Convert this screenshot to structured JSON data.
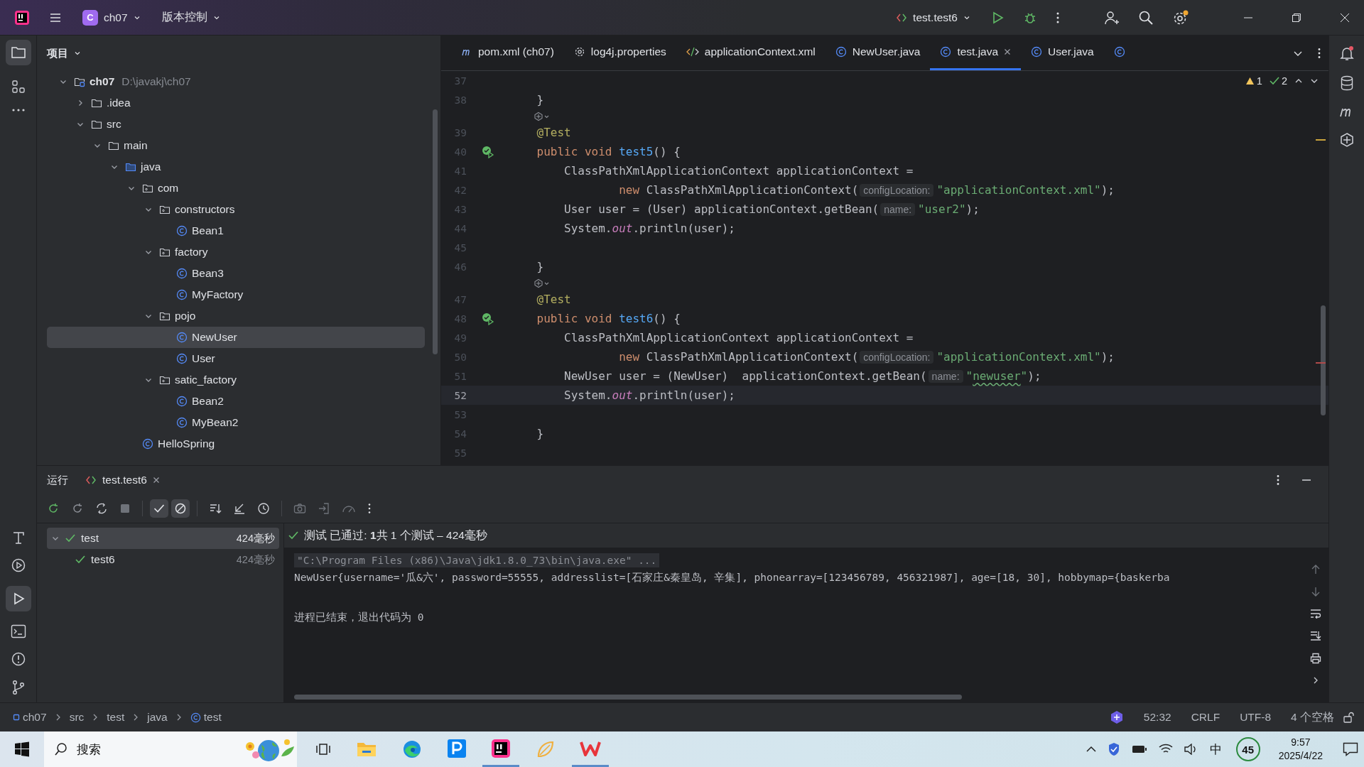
{
  "title_bar": {
    "project_badge": "C",
    "project": "ch07",
    "vcs": "版本控制",
    "run_config": "test.test6",
    "settings_update": true
  },
  "project_panel": {
    "title": "项目",
    "tree": [
      {
        "kind": "project",
        "label": "ch07",
        "path": "D:\\javakj\\ch07",
        "expanded": true,
        "selected": false,
        "children": [
          {
            "kind": "folder",
            "label": ".idea",
            "expanded": false,
            "selected": false
          },
          {
            "kind": "folder",
            "label": "src",
            "expanded": true,
            "selected": false,
            "children": [
              {
                "kind": "folder",
                "label": "main",
                "expanded": true,
                "selected": false,
                "children": [
                  {
                    "kind": "source-folder",
                    "label": "java",
                    "expanded": true,
                    "selected": false,
                    "children": [
                      {
                        "kind": "package",
                        "label": "com",
                        "expanded": true,
                        "selected": false,
                        "children": [
                          {
                            "kind": "package",
                            "label": "constructors",
                            "expanded": true,
                            "selected": false,
                            "children": [
                              {
                                "kind": "class",
                                "label": "Bean1",
                                "selected": false
                              }
                            ]
                          },
                          {
                            "kind": "package",
                            "label": "factory",
                            "expanded": true,
                            "selected": false,
                            "children": [
                              {
                                "kind": "class",
                                "label": "Bean3",
                                "selected": false
                              },
                              {
                                "kind": "class",
                                "label": "MyFactory",
                                "selected": false
                              }
                            ]
                          },
                          {
                            "kind": "package",
                            "label": "pojo",
                            "expanded": true,
                            "selected": false,
                            "children": [
                              {
                                "kind": "class",
                                "label": "NewUser",
                                "selected": true
                              },
                              {
                                "kind": "class",
                                "label": "User",
                                "selected": false
                              }
                            ]
                          },
                          {
                            "kind": "package",
                            "label": "satic_factory",
                            "expanded": true,
                            "selected": false,
                            "children": [
                              {
                                "kind": "class",
                                "label": "Bean2",
                                "selected": false
                              },
                              {
                                "kind": "class",
                                "label": "MyBean2",
                                "selected": false
                              }
                            ]
                          }
                        ]
                      },
                      {
                        "kind": "class",
                        "label": "HelloSpring",
                        "selected": false
                      }
                    ]
                  }
                ]
              }
            ]
          }
        ]
      }
    ]
  },
  "tabs": [
    {
      "kind": "maven",
      "label": "pom.xml (ch07)",
      "selected": false
    },
    {
      "kind": "properties",
      "label": "log4j.properties",
      "selected": false
    },
    {
      "kind": "xml",
      "label": "applicationContext.xml",
      "selected": false
    },
    {
      "kind": "class",
      "label": "NewUser.java",
      "selected": false
    },
    {
      "kind": "class",
      "label": "test.java",
      "selected": true
    },
    {
      "kind": "class",
      "label": "User.java",
      "selected": false
    },
    {
      "kind": "class",
      "selected": false
    }
  ],
  "editor": {
    "warnings": "1",
    "checks": "2",
    "lines": [
      {
        "kind": "code",
        "number": "37",
        "current": false,
        "run_marker": false
      },
      {
        "kind": "code",
        "number": "38",
        "current": false,
        "run_marker": false,
        "tokens": [
          {
            "t": "    }",
            "kind": "plain"
          }
        ]
      },
      {
        "kind": "inlay"
      },
      {
        "kind": "code",
        "number": "39",
        "current": false,
        "run_marker": false,
        "tokens": [
          {
            "t": "    @Test",
            "kind": "anno"
          }
        ]
      },
      {
        "kind": "code",
        "number": "40",
        "current": false,
        "run_marker": true,
        "tokens": [
          {
            "t": "    public void ",
            "kind": "kw"
          },
          {
            "t": "test5",
            "kind": "fn"
          },
          {
            "t": "() {",
            "kind": "plain"
          }
        ]
      },
      {
        "kind": "code",
        "number": "41",
        "current": false,
        "run_marker": false,
        "tokens": [
          {
            "t": "        ClassPathXmlApplicationContext applicationContext =",
            "kind": "plain"
          }
        ]
      },
      {
        "kind": "code",
        "number": "42",
        "current": false,
        "run_marker": false,
        "tokens": [
          {
            "t": "                new ",
            "kind": "kw"
          },
          {
            "t": "ClassPathXmlApplicationContext(",
            "kind": "plain"
          },
          {
            "t": "configLocation:",
            "kind": "hint"
          },
          {
            "t": "\"applicationContext.xml\"",
            "kind": "str"
          },
          {
            "t": ");",
            "kind": "plain"
          }
        ]
      },
      {
        "kind": "code",
        "number": "43",
        "current": false,
        "run_marker": false,
        "tokens": [
          {
            "t": "        User user = (User) applicationContext.getBean(",
            "kind": "plain"
          },
          {
            "t": "name:",
            "kind": "hint"
          },
          {
            "t": "\"user2\"",
            "kind": "str"
          },
          {
            "t": ");",
            "kind": "plain"
          }
        ]
      },
      {
        "kind": "code",
        "number": "44",
        "current": false,
        "run_marker": false,
        "tokens": [
          {
            "t": "        System.",
            "kind": "plain"
          },
          {
            "t": "out",
            "kind": "field"
          },
          {
            "t": ".println(user);",
            "kind": "plain"
          }
        ]
      },
      {
        "kind": "code",
        "number": "45",
        "current": false,
        "run_marker": false
      },
      {
        "kind": "code",
        "number": "46",
        "current": false,
        "run_marker": false,
        "tokens": [
          {
            "t": "    }",
            "kind": "plain"
          }
        ]
      },
      {
        "kind": "inlay"
      },
      {
        "kind": "code",
        "number": "47",
        "current": false,
        "run_marker": false,
        "tokens": [
          {
            "t": "    @Test",
            "kind": "anno"
          }
        ]
      },
      {
        "kind": "code",
        "number": "48",
        "current": false,
        "run_marker": true,
        "tokens": [
          {
            "t": "    public void ",
            "kind": "kw"
          },
          {
            "t": "test6",
            "kind": "fn"
          },
          {
            "t": "() {",
            "kind": "plain"
          }
        ]
      },
      {
        "kind": "code",
        "number": "49",
        "current": false,
        "run_marker": false,
        "tokens": [
          {
            "t": "        ClassPathXmlApplicationContext applicationContext =",
            "kind": "plain"
          }
        ]
      },
      {
        "kind": "code",
        "number": "50",
        "current": false,
        "run_marker": false,
        "tokens": [
          {
            "t": "                new ",
            "kind": "kw"
          },
          {
            "t": "ClassPathXmlApplicationContext(",
            "kind": "plain"
          },
          {
            "t": "configLocation:",
            "kind": "hint"
          },
          {
            "t": "\"applicationContext.xml\"",
            "kind": "str"
          },
          {
            "t": ");",
            "kind": "plain"
          }
        ]
      },
      {
        "kind": "code",
        "number": "51",
        "current": false,
        "run_marker": false,
        "tokens": [
          {
            "t": "        NewUser user = (NewUser)  applicationContext.getBean(",
            "kind": "plain"
          },
          {
            "t": "name:",
            "kind": "hint"
          },
          {
            "t": "\"",
            "kind": "str"
          },
          {
            "t": "newuser",
            "kind": "typo"
          },
          {
            "t": "\"",
            "kind": "str"
          },
          {
            "t": ");",
            "kind": "plain"
          }
        ]
      },
      {
        "kind": "code",
        "number": "52",
        "current": true,
        "run_marker": false,
        "tokens": [
          {
            "t": "        System.",
            "kind": "plain"
          },
          {
            "t": "out",
            "kind": "field"
          },
          {
            "t": ".println(user);",
            "kind": "plain"
          }
        ]
      },
      {
        "kind": "code",
        "number": "53",
        "current": false,
        "run_marker": false
      },
      {
        "kind": "code",
        "number": "54",
        "current": false,
        "run_marker": false,
        "tokens": [
          {
            "t": "    }",
            "kind": "plain"
          }
        ]
      },
      {
        "kind": "code",
        "number": "55",
        "current": false,
        "run_marker": false
      }
    ]
  },
  "run_panel": {
    "title": "运行",
    "tab": "test.test6",
    "show_passed": true,
    "show_ignored": true,
    "tests": [
      {
        "name": "test",
        "time": "424毫秒",
        "passed": true,
        "selected": true,
        "expanded": true,
        "children": [
          {
            "name": "test6",
            "time": "424毫秒",
            "passed": true,
            "selected": false
          }
        ]
      }
    ],
    "summary": "测试 已通过: **1**共 1 个测试 – 424毫秒",
    "console": [
      {
        "kind": "command",
        "text": "\"C:\\Program Files (x86)\\Java\\jdk1.8.0_73\\bin\\java.exe\" ..."
      },
      {
        "kind": "output",
        "text": "NewUser{username='瓜&六', password=55555, addresslist=[石家庄&秦皇岛, 辛集], phonearray=[123456789, 456321987], age=[18, 30], hobbymap={baskerba"
      },
      {
        "kind": "blank"
      },
      {
        "kind": "output",
        "text": "进程已结束，退出代码为 0"
      }
    ]
  },
  "breadcrumbs": [
    {
      "kind": "module",
      "label": "ch07"
    },
    {
      "kind": "folder",
      "label": "src"
    },
    {
      "kind": "folder",
      "label": "test"
    },
    {
      "kind": "folder",
      "label": "java"
    },
    {
      "kind": "class",
      "label": "test"
    }
  ],
  "status": [
    "52:32",
    "CRLF",
    "UTF-8",
    "4 个空格"
  ],
  "taskbar": {
    "search": "搜索",
    "ime": "中",
    "badge": "45",
    "time": "9:57",
    "date": "2025/4/22"
  }
}
